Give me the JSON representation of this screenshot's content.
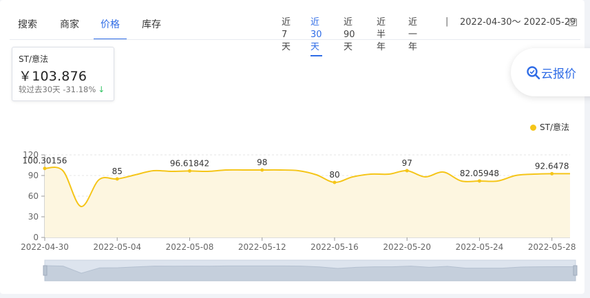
{
  "tabs": [
    {
      "label": "搜索",
      "active": false
    },
    {
      "label": "商家",
      "active": false
    },
    {
      "label": "价格",
      "active": true
    },
    {
      "label": "库存",
      "active": false
    }
  ],
  "ranges": [
    {
      "label": "近7天",
      "active": false
    },
    {
      "label": "近30天",
      "active": true
    },
    {
      "label": "近90天",
      "active": false
    },
    {
      "label": "近半年",
      "active": false
    },
    {
      "label": "近一年",
      "active": false
    }
  ],
  "range_separator": "|",
  "date_range": "2022-04-30～ 2022-05-29",
  "info": {
    "title": "ST/意法",
    "price": "￥103.876",
    "change_label": "较过去30天",
    "change_value": "-31.18%"
  },
  "quote_button": {
    "label": "云报价",
    "icon": "search-quote-icon"
  },
  "colors": {
    "accent": "#2f6ce6",
    "series": "#f5c518",
    "area": "#fdf6e0",
    "down": "#35c466"
  },
  "chart_data": {
    "type": "area",
    "title": "",
    "xlabel": "",
    "ylabel": "",
    "ylim": [
      0,
      120
    ],
    "yticks": [
      "0",
      "30",
      "60",
      "90",
      "120"
    ],
    "x_range": [
      "2022-04-30",
      "2022-05-29"
    ],
    "xticks": [
      "2022-04-30",
      "2022-05-04",
      "2022-05-08",
      "2022-05-12",
      "2022-05-16",
      "2022-05-20",
      "2022-05-24",
      "2022-05-28"
    ],
    "legend": {
      "position": "top-right"
    },
    "grid": true,
    "series": [
      {
        "name": "ST/意法",
        "points": [
          {
            "x": "2022-04-30",
            "y": 100.30156,
            "label": "100.30156"
          },
          {
            "x": "2022-05-01",
            "y": 97
          },
          {
            "x": "2022-05-02",
            "y": 45
          },
          {
            "x": "2022-05-03",
            "y": 84
          },
          {
            "x": "2022-05-04",
            "y": 85,
            "label": "85"
          },
          {
            "x": "2022-05-05",
            "y": 91
          },
          {
            "x": "2022-05-06",
            "y": 97
          },
          {
            "x": "2022-05-07",
            "y": 96
          },
          {
            "x": "2022-05-08",
            "y": 96.61842,
            "label": "96.61842"
          },
          {
            "x": "2022-05-09",
            "y": 96
          },
          {
            "x": "2022-05-10",
            "y": 98
          },
          {
            "x": "2022-05-11",
            "y": 98
          },
          {
            "x": "2022-05-12",
            "y": 98,
            "label": "98"
          },
          {
            "x": "2022-05-13",
            "y": 98
          },
          {
            "x": "2022-05-14",
            "y": 97
          },
          {
            "x": "2022-05-15",
            "y": 91
          },
          {
            "x": "2022-05-16",
            "y": 80,
            "label": "80"
          },
          {
            "x": "2022-05-17",
            "y": 88
          },
          {
            "x": "2022-05-18",
            "y": 92
          },
          {
            "x": "2022-05-19",
            "y": 92
          },
          {
            "x": "2022-05-20",
            "y": 97,
            "label": "97"
          },
          {
            "x": "2022-05-21",
            "y": 88
          },
          {
            "x": "2022-05-22",
            "y": 95
          },
          {
            "x": "2022-05-23",
            "y": 82
          },
          {
            "x": "2022-05-24",
            "y": 82.05948,
            "label": "82.05948"
          },
          {
            "x": "2022-05-25",
            "y": 82
          },
          {
            "x": "2022-05-26",
            "y": 90
          },
          {
            "x": "2022-05-27",
            "y": 92
          },
          {
            "x": "2022-05-28",
            "y": 92.6478,
            "label": "92.6478"
          },
          {
            "x": "2022-05-29",
            "y": 92.6
          }
        ]
      }
    ]
  }
}
